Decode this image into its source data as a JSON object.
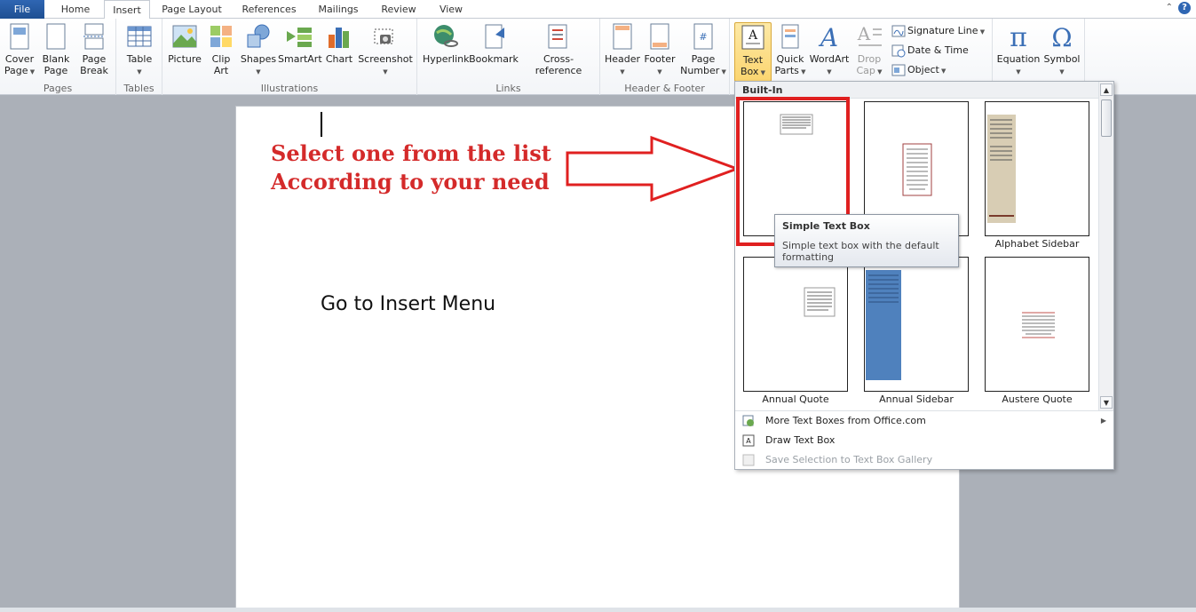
{
  "tabs": [
    {
      "label": "File"
    },
    {
      "label": "Home"
    },
    {
      "label": "Insert"
    },
    {
      "label": "Page Layout"
    },
    {
      "label": "References"
    },
    {
      "label": "Mailings"
    },
    {
      "label": "Review"
    },
    {
      "label": "View"
    }
  ],
  "ribbon": {
    "pages": {
      "label": "Pages",
      "cover_page": "Cover\nPage",
      "blank_page": "Blank\nPage",
      "page_break": "Page\nBreak"
    },
    "tables": {
      "label": "Tables",
      "table": "Table"
    },
    "illustrations": {
      "label": "Illustrations",
      "picture": "Picture",
      "clip_art": "Clip\nArt",
      "shapes": "Shapes",
      "smartart": "SmartArt",
      "chart": "Chart",
      "screenshot": "Screenshot"
    },
    "links": {
      "label": "Links",
      "hyperlink": "Hyperlink",
      "bookmark": "Bookmark",
      "cross_reference": "Cross-reference"
    },
    "header_footer": {
      "label": "Header & Footer",
      "header": "Header",
      "footer": "Footer",
      "page_number": "Page\nNumber"
    },
    "text": {
      "text_box": "Text\nBox",
      "quick_parts": "Quick\nParts",
      "wordart": "WordArt",
      "drop_cap": "Drop\nCap",
      "signature_line": "Signature Line",
      "date_time": "Date & Time",
      "object": "Object"
    },
    "symbols": {
      "equation": "Equation",
      "symbol": "Symbol"
    }
  },
  "document": {
    "annotation_line1": "Select one from the list",
    "annotation_line2": "According to your need",
    "instruction": "Go to Insert Menu"
  },
  "gallery": {
    "header": "Built-In",
    "items": [
      {
        "label": "Simple Text Box"
      },
      {
        "label": ""
      },
      {
        "label": "Alphabet Sidebar"
      },
      {
        "label": "Annual Quote"
      },
      {
        "label": "Annual Sidebar"
      },
      {
        "label": "Austere Quote"
      }
    ],
    "menu": {
      "more": "More Text Boxes from Office.com",
      "draw": "Draw Text Box",
      "save": "Save Selection to Text Box Gallery"
    },
    "tooltip": {
      "title": "Simple Text Box",
      "body": "Simple text box with the default formatting"
    }
  },
  "colors": {
    "annotation_red": "#d42a2a",
    "file_tab": "#2b579a"
  }
}
